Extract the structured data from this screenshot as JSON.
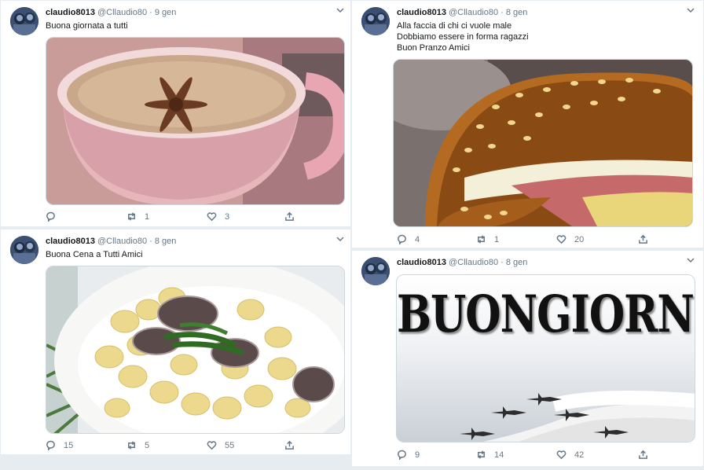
{
  "tweets": [
    {
      "name": "claudio8013",
      "handle": "@Cllaudio80",
      "date": "9 gen",
      "text": [
        "Buona giornata a tutti"
      ],
      "media_desc": "cappuccino-with-star-anise",
      "stats": {
        "replies": "",
        "retweets": "1",
        "likes": "3"
      }
    },
    {
      "name": "claudio8013",
      "handle": "@Cllaudio80",
      "date": "8 gen",
      "text": [
        "Alla faccia di chi ci vuole male",
        "Dobbiamo essere in forma ragazzi",
        "Buon Pranzo Amici"
      ],
      "media_desc": "sesame-bread-sandwich",
      "stats": {
        "replies": "4",
        "retweets": "1",
        "likes": "20"
      }
    },
    {
      "name": "claudio8013",
      "handle": "@Cllaudio80",
      "date": "8 gen",
      "text": [
        "Buona Cena a Tutti Amici"
      ],
      "media_desc": "orecchiette-with-clams",
      "stats": {
        "replies": "15",
        "retweets": "5",
        "likes": "55"
      }
    },
    {
      "name": "claudio8013",
      "handle": "@Cllaudio80",
      "date": "8 gen",
      "text": [],
      "media_text": "BUONGIORNO",
      "media_desc": "aerobatic-jets-with-smoke",
      "stats": {
        "replies": "9",
        "retweets": "14",
        "likes": "42"
      }
    }
  ],
  "icons": {
    "reply": "reply-icon",
    "retweet": "retweet-icon",
    "like": "heart-icon",
    "share": "share-icon",
    "menu": "chevron-down-icon"
  }
}
